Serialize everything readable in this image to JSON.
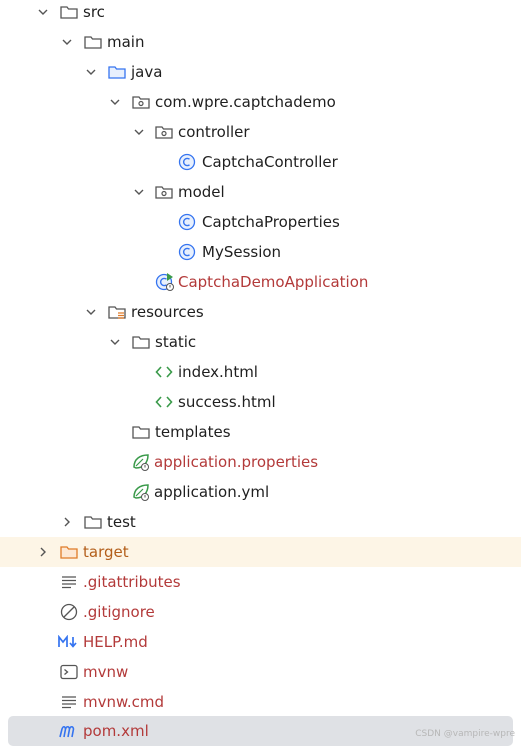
{
  "tree": {
    "items": [
      {
        "label": "src",
        "icon": "folder-icon"
      },
      {
        "label": "main",
        "icon": "folder-icon"
      },
      {
        "label": "java",
        "icon": "source-folder-icon"
      },
      {
        "label": "com.wpre.captchademo",
        "icon": "package-icon"
      },
      {
        "label": "controller",
        "icon": "package-icon"
      },
      {
        "label": "CaptchaController",
        "icon": "class-icon"
      },
      {
        "label": "model",
        "icon": "package-icon"
      },
      {
        "label": "CaptchaProperties",
        "icon": "class-icon"
      },
      {
        "label": "MySession",
        "icon": "class-icon"
      },
      {
        "label": "CaptchaDemoApplication",
        "icon": "spring-boot-class-icon"
      },
      {
        "label": "resources",
        "icon": "resources-folder-icon"
      },
      {
        "label": "static",
        "icon": "folder-icon"
      },
      {
        "label": "index.html",
        "icon": "html-file-icon"
      },
      {
        "label": "success.html",
        "icon": "html-file-icon"
      },
      {
        "label": "templates",
        "icon": "folder-icon"
      },
      {
        "label": "application.properties",
        "icon": "spring-properties-icon"
      },
      {
        "label": "application.yml",
        "icon": "spring-yml-icon"
      },
      {
        "label": "test",
        "icon": "folder-icon"
      },
      {
        "label": "target",
        "icon": "excluded-folder-icon"
      },
      {
        "label": ".gitattributes",
        "icon": "text-file-icon"
      },
      {
        "label": ".gitignore",
        "icon": "gitignore-icon"
      },
      {
        "label": "HELP.md",
        "icon": "markdown-icon"
      },
      {
        "label": "mvnw",
        "icon": "shell-script-icon"
      },
      {
        "label": "mvnw.cmd",
        "icon": "text-file-icon"
      },
      {
        "label": "pom.xml",
        "icon": "maven-icon"
      }
    ]
  },
  "colors": {
    "modified_red": "#b33a3a",
    "target_highlight": "#fdf5e6",
    "selection": "#dfe1e5",
    "icon_blue": "#3574f0",
    "icon_green": "#3a9a4a"
  },
  "watermark": "CSDN @vampire-wpre"
}
